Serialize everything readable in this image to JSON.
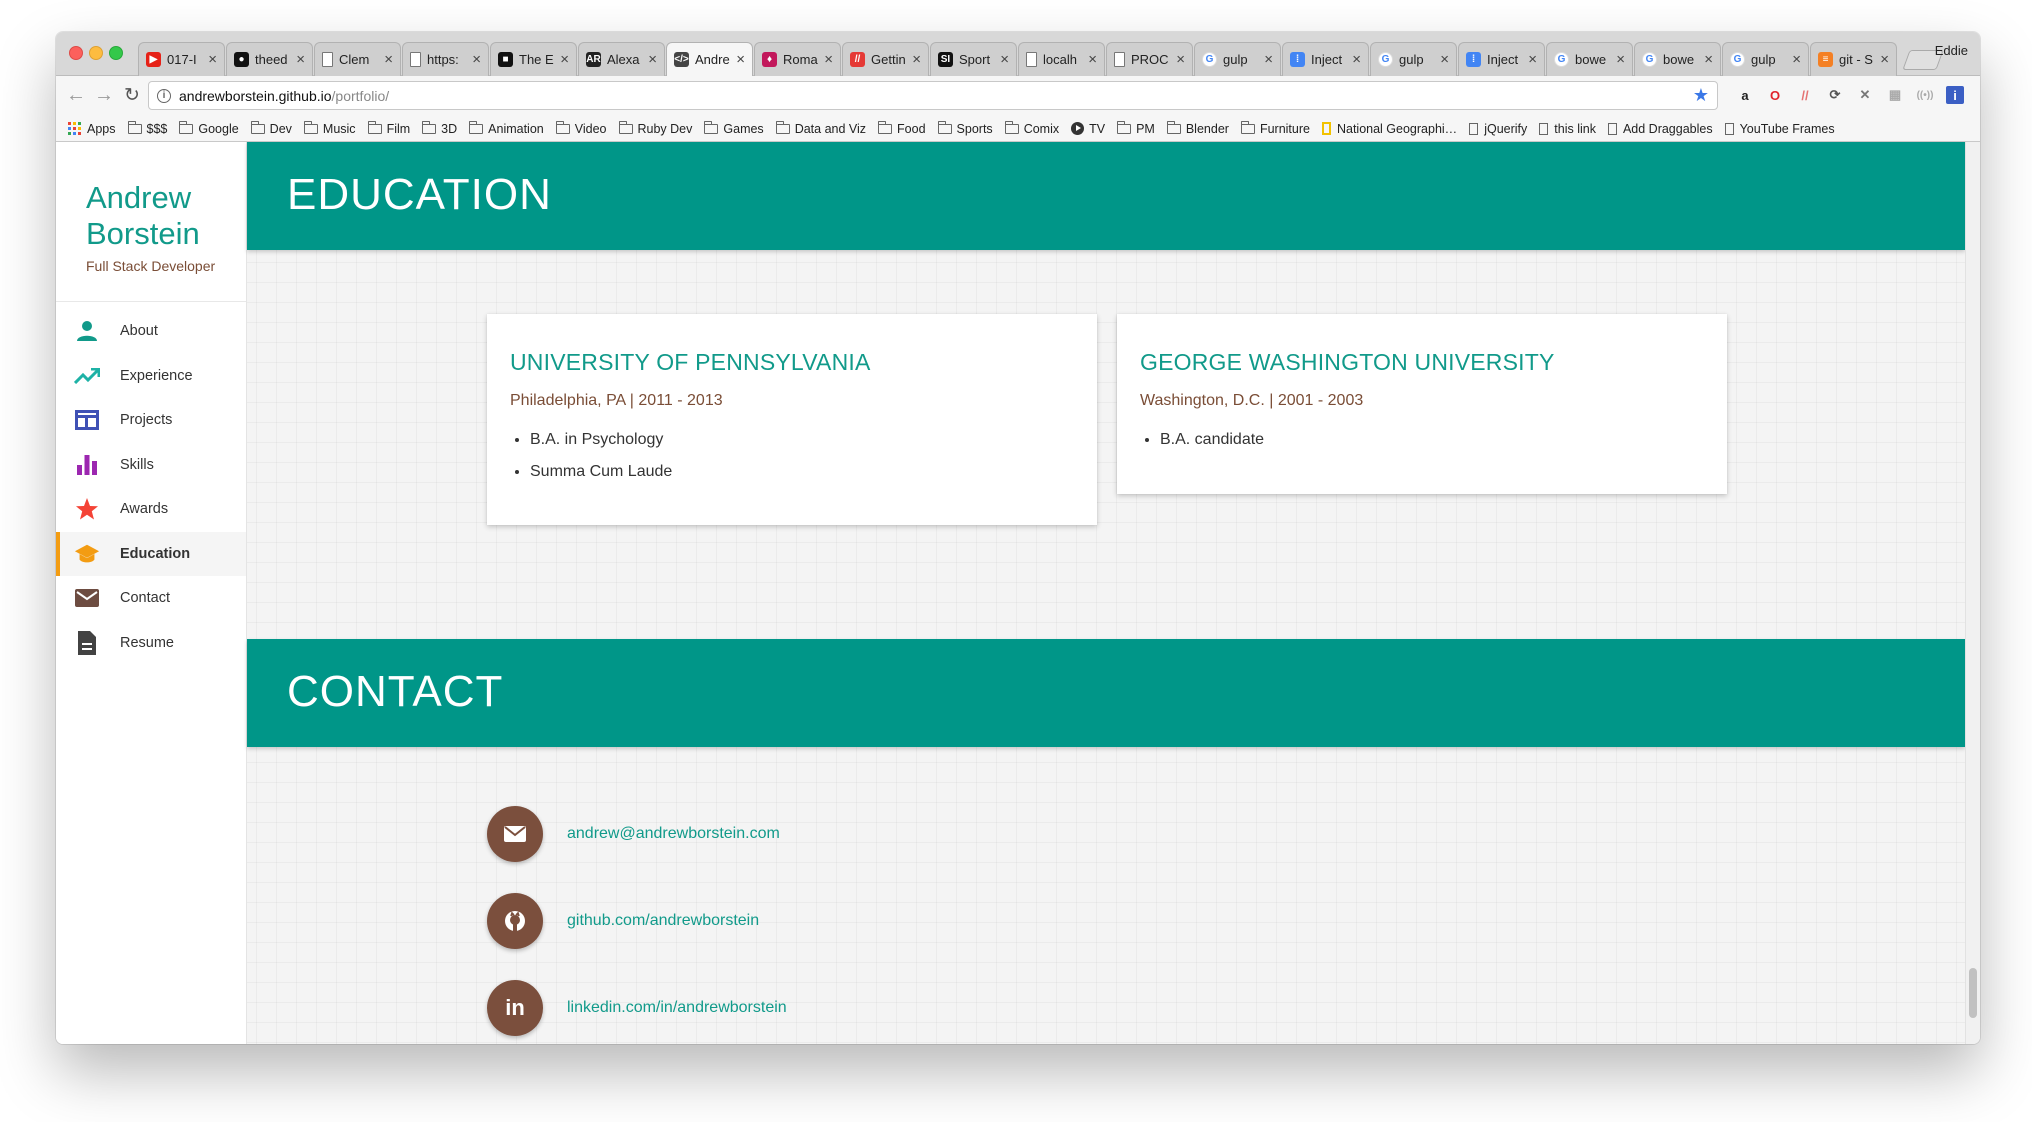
{
  "browser": {
    "profile_name": "Eddie",
    "tabs": [
      {
        "title": "017-I",
        "icon": "youtube-icon",
        "color": "#e62117",
        "glyph": "▶"
      },
      {
        "title": "theed",
        "icon": "github-icon",
        "color": "#111111",
        "glyph": "●"
      },
      {
        "title": "Clem",
        "icon": "page-icon",
        "color": "#ffffff",
        "glyph": ""
      },
      {
        "title": "https:",
        "icon": "page-icon",
        "color": "#ffffff",
        "glyph": ""
      },
      {
        "title": "The E",
        "icon": "site-icon",
        "color": "#111111",
        "glyph": "■"
      },
      {
        "title": "Alexa",
        "icon": "ar-icon",
        "color": "#222222",
        "glyph": "AR"
      },
      {
        "title": "Andre",
        "icon": "code-icon",
        "color": "#444444",
        "glyph": "</>",
        "active": true
      },
      {
        "title": "Roma",
        "icon": "ruby-icon",
        "color": "#c2185b",
        "glyph": "♦"
      },
      {
        "title": "Gettin",
        "icon": "slash-icon",
        "color": "#e53935",
        "glyph": "//"
      },
      {
        "title": "Sport",
        "icon": "si-icon",
        "color": "#111111",
        "glyph": "SI"
      },
      {
        "title": "localh",
        "icon": "page-icon",
        "color": "#ffffff",
        "glyph": ""
      },
      {
        "title": "PROC",
        "icon": "page-icon",
        "color": "#ffffff",
        "glyph": ""
      },
      {
        "title": "gulp",
        "icon": "google-icon",
        "color": "#4285f4",
        "glyph": "G"
      },
      {
        "title": "Inject",
        "icon": "dots-icon",
        "color": "#4285f4",
        "glyph": "⁞"
      },
      {
        "title": "gulp",
        "icon": "google-icon",
        "color": "#4285f4",
        "glyph": "G"
      },
      {
        "title": "Inject",
        "icon": "dots-icon",
        "color": "#4285f4",
        "glyph": "⁞"
      },
      {
        "title": "bowe",
        "icon": "google-icon",
        "color": "#4285f4",
        "glyph": "G"
      },
      {
        "title": "bowe",
        "icon": "google-icon",
        "color": "#4285f4",
        "glyph": "G"
      },
      {
        "title": "gulp",
        "icon": "google-icon",
        "color": "#4285f4",
        "glyph": "G"
      },
      {
        "title": "git - S",
        "icon": "stack-icon",
        "color": "#f48024",
        "glyph": "≡"
      }
    ],
    "url_host": "andrewborstein.github.io",
    "url_path": "/portfolio/",
    "bookmarks": [
      {
        "label": "Apps",
        "icon": "apps-icon"
      },
      {
        "label": "$$$",
        "icon": "folder-icon"
      },
      {
        "label": "Google",
        "icon": "folder-icon"
      },
      {
        "label": "Dev",
        "icon": "folder-icon"
      },
      {
        "label": "Music",
        "icon": "folder-icon"
      },
      {
        "label": "Film",
        "icon": "folder-icon"
      },
      {
        "label": "3D",
        "icon": "folder-icon"
      },
      {
        "label": "Animation",
        "icon": "folder-icon"
      },
      {
        "label": "Video",
        "icon": "folder-icon"
      },
      {
        "label": "Ruby Dev",
        "icon": "folder-icon"
      },
      {
        "label": "Games",
        "icon": "folder-icon"
      },
      {
        "label": "Data and Viz",
        "icon": "folder-icon"
      },
      {
        "label": "Food",
        "icon": "folder-icon"
      },
      {
        "label": "Sports",
        "icon": "folder-icon"
      },
      {
        "label": "Comix",
        "icon": "folder-icon"
      },
      {
        "label": "TV",
        "icon": "play-icon"
      },
      {
        "label": "PM",
        "icon": "folder-icon"
      },
      {
        "label": "Blender",
        "icon": "folder-icon"
      },
      {
        "label": "Furniture",
        "icon": "folder-icon"
      },
      {
        "label": "National Geographi…",
        "icon": "natgeo-icon"
      },
      {
        "label": "jQuerify",
        "icon": "page-icon"
      },
      {
        "label": "this link",
        "icon": "page-icon"
      },
      {
        "label": "Add Draggables",
        "icon": "page-icon"
      },
      {
        "label": "YouTube Frames",
        "icon": "page-icon"
      }
    ]
  },
  "sidebar": {
    "name_first": "Andrew",
    "name_last": "Borstein",
    "role": "Full Stack Developer",
    "items": [
      {
        "label": "About",
        "icon": "person-icon",
        "color": "#119a8a"
      },
      {
        "label": "Experience",
        "icon": "trending-up-icon",
        "color": "#1eb2a6"
      },
      {
        "label": "Projects",
        "icon": "web-icon",
        "color": "#3f51b5"
      },
      {
        "label": "Skills",
        "icon": "bar-chart-icon",
        "color": "#9c27b0"
      },
      {
        "label": "Awards",
        "icon": "star-icon",
        "color": "#f44336"
      },
      {
        "label": "Education",
        "icon": "school-icon",
        "color": "#f39c12",
        "active": true
      },
      {
        "label": "Contact",
        "icon": "envelope-icon",
        "color": "#6d4c41"
      },
      {
        "label": "Resume",
        "icon": "document-icon",
        "color": "#424242"
      }
    ]
  },
  "education": {
    "heading": "EDUCATION",
    "schools": [
      {
        "name": "UNIVERSITY OF PENNSYLVANIA",
        "meta": "Philadelphia, PA | 2011 - 2013",
        "details": [
          "B.A. in Psychology",
          "Summa Cum Laude"
        ]
      },
      {
        "name": "GEORGE WASHINGTON UNIVERSITY",
        "meta": "Washington, D.C. | 2001 - 2003",
        "details": [
          "B.A. candidate"
        ]
      }
    ]
  },
  "contact": {
    "heading": "CONTACT",
    "email": "andrew@andrewborstein.com",
    "github": "github.com/andrewborstein",
    "linkedin": "linkedin.com/in/andrewborstein"
  },
  "colors": {
    "accent": "#009688",
    "accent_text": "#119a8a",
    "brown": "#7b4f3d",
    "active_marker": "#f39c12"
  }
}
